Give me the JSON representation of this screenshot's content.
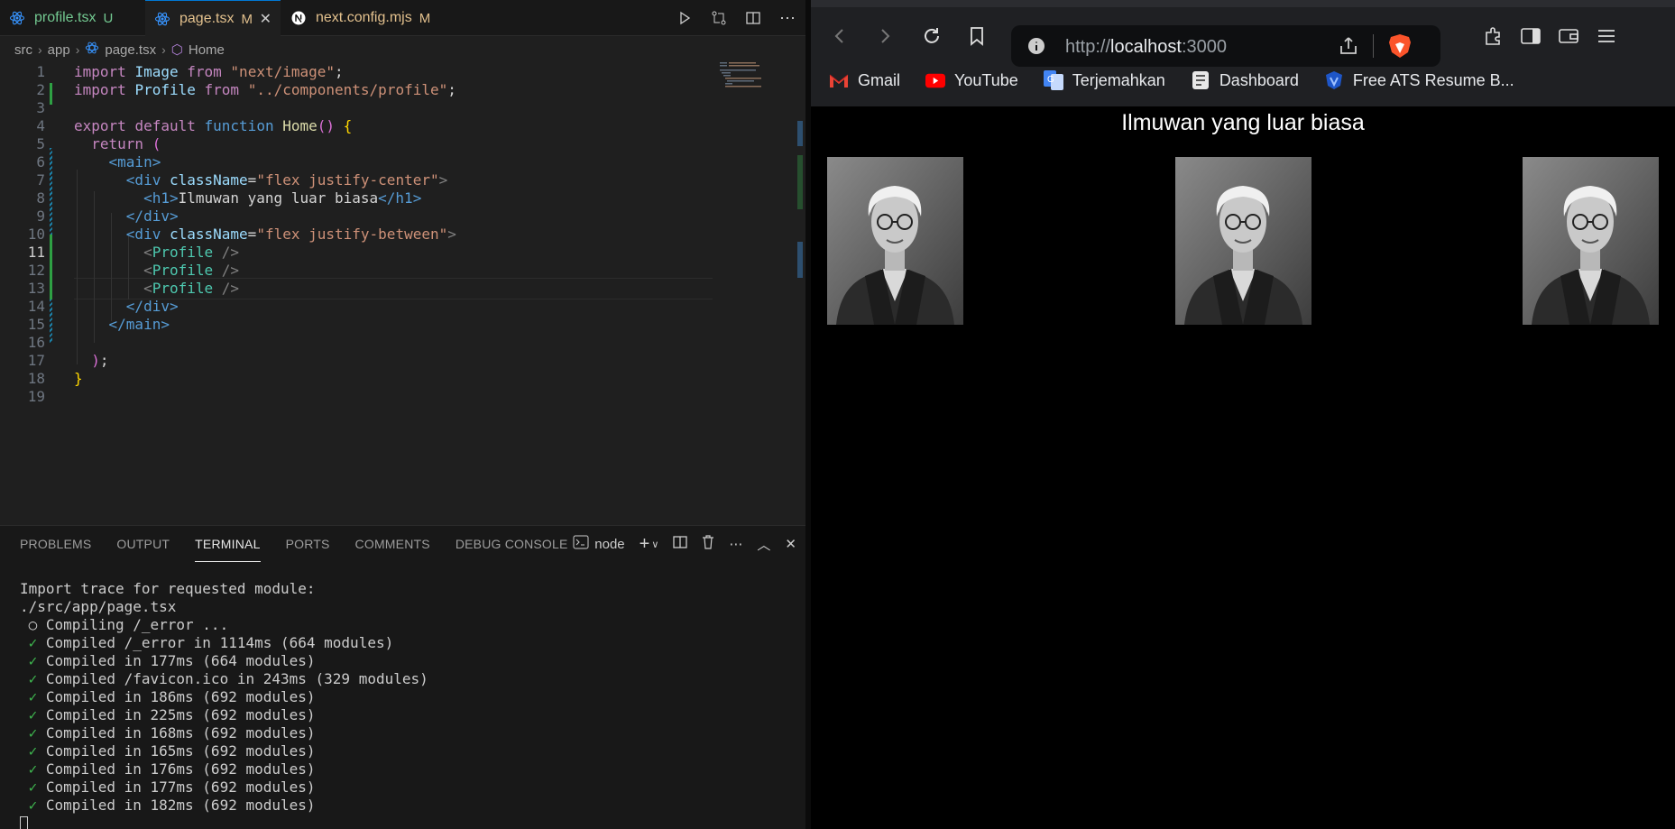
{
  "vscode": {
    "tabs": [
      {
        "name": "profile.tsx",
        "status": "U"
      },
      {
        "name": "page.tsx",
        "status": "M",
        "close": "✕"
      },
      {
        "name": "next.config.mjs",
        "status": "M"
      }
    ],
    "breadcrumb": [
      "src",
      "app",
      "page.tsx",
      "Home"
    ],
    "code_lines": [
      {
        "n": "1"
      },
      {
        "n": "2"
      },
      {
        "n": "3"
      },
      {
        "n": "4"
      },
      {
        "n": "5"
      },
      {
        "n": "6"
      },
      {
        "n": "7"
      },
      {
        "n": "8"
      },
      {
        "n": "9"
      },
      {
        "n": "10"
      },
      {
        "n": "11"
      },
      {
        "n": "12"
      },
      {
        "n": "13"
      },
      {
        "n": "14"
      },
      {
        "n": "15"
      },
      {
        "n": "16"
      },
      {
        "n": "17"
      },
      {
        "n": "18"
      },
      {
        "n": "19"
      }
    ],
    "code": {
      "l1": {
        "kw": "import",
        "name": "Image",
        "from": "from",
        "path": "\"next/image\"",
        "end": ";"
      },
      "l2": {
        "kw": "import",
        "name": "Profile",
        "from": "from",
        "path": "\"../components/profile\"",
        "end": ";"
      },
      "l4": {
        "export": "export",
        "default": "default",
        "function": "function",
        "fname": "Home",
        "parens": "()",
        "brace": "{"
      },
      "l5": {
        "ret": "return",
        "paren": "("
      },
      "l6": {
        "tag": "<main>"
      },
      "l7": {
        "open": "<div",
        "attr": "className",
        "eq": "=",
        "val": "\"flex justify-center\"",
        "close": ">"
      },
      "l8": {
        "open": "<h1>",
        "text": "Ilmuwan yang luar biasa",
        "close": "</h1>"
      },
      "l9": {
        "tag": "</div>"
      },
      "l10": {
        "open": "<div",
        "attr": "className",
        "eq": "=",
        "val": "\"flex justify-between\"",
        "close": ">"
      },
      "l11": {
        "lt": "<",
        "cmp": "Profile",
        "end": " />"
      },
      "l12": {
        "lt": "<",
        "cmp": "Profile",
        "end": " />"
      },
      "l13": {
        "lt": "<",
        "cmp": "Profile",
        "end": " />"
      },
      "l14": {
        "tag": "</div>"
      },
      "l15": {
        "tag": "</main>"
      },
      "l17": {
        "paren": ")",
        "end": ";"
      },
      "l18": {
        "brace": "}"
      }
    },
    "panel": {
      "tabs": [
        "PROBLEMS",
        "OUTPUT",
        "TERMINAL",
        "PORTS",
        "COMMENTS",
        "DEBUG CONSOLE"
      ],
      "active_tab": "TERMINAL",
      "terminal_name": "node"
    },
    "terminal_lines": [
      {
        "prefix": "",
        "text": "Import trace for requested module:"
      },
      {
        "prefix": "",
        "text": "./src/app/page.tsx"
      },
      {
        "prefix": " ○ ",
        "text": "Compiling /_error ..."
      },
      {
        "prefix": " ✓ ",
        "text": "Compiled /_error in 1114ms (664 modules)"
      },
      {
        "prefix": " ✓ ",
        "text": "Compiled in 177ms (664 modules)"
      },
      {
        "prefix": " ✓ ",
        "text": "Compiled /favicon.ico in 243ms (329 modules)"
      },
      {
        "prefix": " ✓ ",
        "text": "Compiled in 186ms (692 modules)"
      },
      {
        "prefix": " ✓ ",
        "text": "Compiled in 225ms (692 modules)"
      },
      {
        "prefix": " ✓ ",
        "text": "Compiled in 168ms (692 modules)"
      },
      {
        "prefix": " ✓ ",
        "text": "Compiled in 165ms (692 modules)"
      },
      {
        "prefix": " ✓ ",
        "text": "Compiled in 176ms (692 modules)"
      },
      {
        "prefix": " ✓ ",
        "text": "Compiled in 177ms (692 modules)"
      },
      {
        "prefix": " ✓ ",
        "text": "Compiled in 182ms (692 modules)"
      }
    ]
  },
  "browser": {
    "url_prefix": "http://",
    "url_host": "localhost",
    "url_port": ":3000",
    "bookmarks": [
      {
        "label": "Gmail",
        "icon": "gmail-icon"
      },
      {
        "label": "YouTube",
        "icon": "youtube-icon"
      },
      {
        "label": "Terjemahkan",
        "icon": "translate-icon"
      },
      {
        "label": "Dashboard",
        "icon": "dashboard-icon"
      },
      {
        "label": "Free ATS Resume B...",
        "icon": "resume-icon"
      }
    ],
    "page_heading": "Ilmuwan yang luar biasa",
    "profiles_count": 3
  },
  "colors": {
    "accent": "#0078d4",
    "git_modified": "#e2c08d",
    "git_untracked": "#73c991",
    "success": "#3fb950"
  }
}
